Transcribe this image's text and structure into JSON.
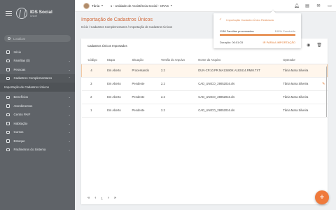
{
  "brand": {
    "title": "IDS Social",
    "subtitle": "Unicef"
  },
  "search": {
    "placeholder": "Localizar"
  },
  "sidebar": {
    "items": [
      {
        "label": "Início",
        "icon": "home-icon"
      },
      {
        "label": "Famílias (0)",
        "icon": "family-icon"
      },
      {
        "label": "Pessoas",
        "icon": "people-icon"
      },
      {
        "label": "Cadastros Complementares",
        "icon": "folder-icon"
      },
      {
        "label": "Importação de Cadastros Únicos",
        "icon": ""
      },
      {
        "label": "Benefícios",
        "icon": "benefit-icon"
      },
      {
        "label": "Atendimentos",
        "icon": "service-icon"
      },
      {
        "label": "Centro PAIF",
        "icon": "center-icon"
      },
      {
        "label": "Habitação",
        "icon": "house-icon"
      },
      {
        "label": "Cursos",
        "icon": "course-icon"
      },
      {
        "label": "Estoque",
        "icon": "stock-icon"
      },
      {
        "label": "Parâmetros do Sistema",
        "icon": "settings-icon"
      }
    ]
  },
  "topbar": {
    "user": "Tânia",
    "unit": "1 - Unidade de Assistência Social - CRAS"
  },
  "header": {
    "title": "Importação de Cadastros Únicos",
    "breadcrumb": "Início / Cadastros Complementares / Importação de Cadastros Únicos"
  },
  "notification": {
    "status": "Importação Cadastro Único Realizada",
    "processed": "1138 Famílias processadas",
    "percent": "100% Concluído",
    "progress": 100,
    "duration": "Duração: 00:01:03",
    "link": "IR PARA A IMPORTAÇÃO"
  },
  "card": {
    "title": "Cadastros Únicos Importados"
  },
  "table": {
    "headers": [
      "Código",
      "Etapa",
      "Situação",
      "Versão do Arquivo",
      "Nome do Arquivo",
      "Operador"
    ],
    "rows": [
      [
        "4",
        "Em Aberto",
        "Processando",
        "2.2",
        "DUN-CP.10.PR.MA13480K.A183414.RMM.TXT",
        "Tânia Mara Silveira"
      ],
      [
        "3",
        "Em Aberto",
        "Pendente",
        "2.2",
        "CAD_UNICO_29052016.xls",
        "Tânia Mara Silveira"
      ],
      [
        "2",
        "Em Aberto",
        "Pendente",
        "2.2",
        "CAD_UNICO_28052016.xls",
        "Tânia Mara Silveira"
      ],
      [
        "1",
        "Em Aberto",
        "Pendente",
        "2.2",
        "CAD_UNICO_29052016.xls",
        "Tânia Mara Silveira"
      ]
    ]
  },
  "pager": {
    "current": "1"
  },
  "colors": {
    "accent": "#e2792f",
    "sidebar": "#5f6368"
  }
}
